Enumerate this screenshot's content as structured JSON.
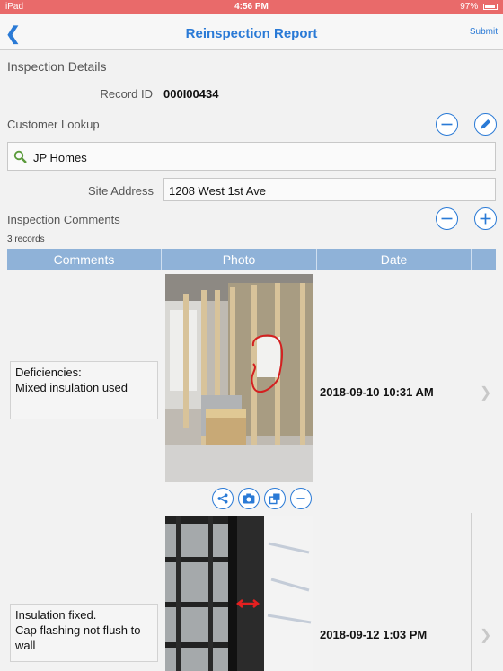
{
  "status": {
    "device": "iPad",
    "time": "4:56 PM",
    "battery": "97%"
  },
  "nav": {
    "back_icon": "chevron-left-icon",
    "title": "Reinspection Report",
    "submit": "Submit"
  },
  "details": {
    "section": "Inspection Details",
    "record_label": "Record ID",
    "record_value": "000I00434"
  },
  "customer": {
    "label": "Customer Lookup",
    "value": "JP Homes",
    "search_icon": "magnifier-icon"
  },
  "address": {
    "label": "Site Address",
    "value": "1208 West 1st Ave"
  },
  "comments": {
    "label": "Inspection Comments",
    "count": "3 records",
    "columns": [
      "Comments",
      "Photo",
      "Date"
    ],
    "rows": [
      {
        "comment": "Deficiencies:\nMixed insulation used",
        "date": "2018-09-10 10:31 AM"
      },
      {
        "comment": "Insulation fixed.\nCap flashing not flush to wall",
        "date": "2018-09-12 1:03 PM"
      }
    ]
  },
  "colors": {
    "accent": "#2a7ad6",
    "status_bar": "#e96a6a",
    "grid_header": "#8fb2d8"
  }
}
